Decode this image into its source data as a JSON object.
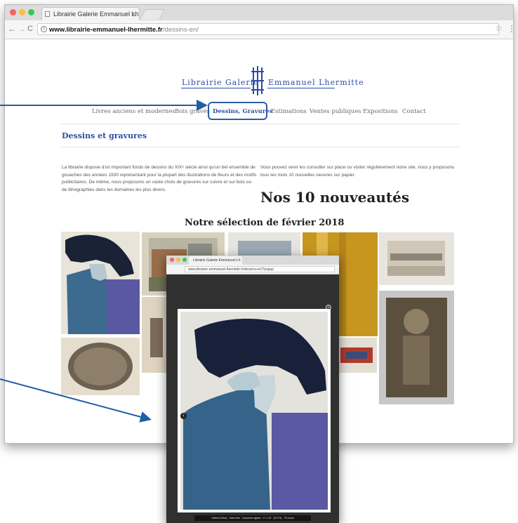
{
  "main_window": {
    "tab_title": "Librairie Galerie Emmanuel Lh",
    "tab_close": "×",
    "url_host": "www.librairie-emmanuel-lhermitte.fr",
    "url_path": "/dessins-en/",
    "info_icon": "i",
    "nav": {
      "back": "←",
      "forward": "→",
      "reload": "C",
      "star": "☆",
      "menu": "⋮"
    }
  },
  "site": {
    "logo": {
      "left": "Librairie Galerie",
      "right": "Emmanuel Lhermitte",
      "monogram": "EL"
    },
    "menu": [
      "Livres anciens et modernes",
      "Bois gravés",
      "Dessins, Gravures",
      "Estimations",
      "Ventes publiques",
      "Expositions",
      "Contact"
    ],
    "active_menu_index": 2,
    "section_title": "Dessins et gravures",
    "intro_left": "La librairie dispose d'un important fonds de dessins du XIXᵉ siècle ainsi qu'un bel ensemble de gouaches des années 1930 représentant pour la plupart des illustrations de fleurs et des motifs publicitaires. De même, nous proposons un vaste choix de gravures sur cuivre et sur bois ou de lithographies dans les domaines les plus divers.",
    "intro_right": "Vous pouvez venir les consulter sur place ou visiter régulièrement notre site, nous y proposons tous les mois 10 nouvelles oeuvres sur papier.",
    "big_heading": "Nos 10 nouveautés",
    "selection_heading": "Notre sélection de février 2018"
  },
  "overlay_window": {
    "tab_title": "Librairie Galerie Emmanuel Lh",
    "url": "www.librairie-emmanuel-lhermitte.fr/dessins-en/?popup",
    "caption": "Hébert (Olive) · Sans titre · Gouache signée · 17 x 22 · (FCTS) · 75 euros",
    "close_glyph": "×",
    "prev_glyph": "‹"
  },
  "colors": {
    "brand_blue": "#2b4da5",
    "annotation_blue": "#2a5da9",
    "lightbox_bg": "#303030"
  },
  "icons": [
    "page-icon",
    "info-icon",
    "star-icon",
    "menu-icon",
    "close-icon",
    "prev-arrow-icon"
  ]
}
